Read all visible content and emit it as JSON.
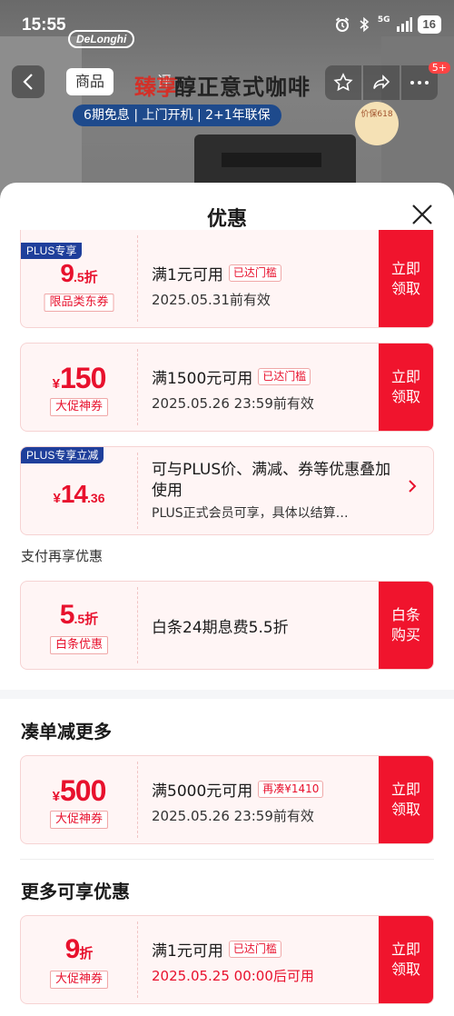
{
  "status_bar": {
    "time": "15:55",
    "network": "5G",
    "battery": "16"
  },
  "background": {
    "brand_logo": "DeLonghi",
    "tabs": [
      {
        "label": "商品"
      },
      {
        "label": "评"
      }
    ],
    "hero_title_red": "臻享",
    "hero_title": "醇正意式咖啡",
    "hero_tags": "6期免息 | 上门开机 | 2+1年联保",
    "price_guard": "价保618",
    "cart_badge": "5+"
  },
  "sheet": {
    "title": "优惠",
    "coupons_top": [
      {
        "plus_tag": "PLUS专享",
        "amount_num": "9",
        "amount_dec": ".5",
        "amount_unit": "折",
        "type": "限品类东券",
        "condition": "满1元可用",
        "status": "已达门槛",
        "validity": "2025.05.31前有效",
        "action": "立即领取"
      },
      {
        "amount_sym": "¥",
        "amount_num": "150",
        "type": "大促神券",
        "condition": "满1500元可用",
        "status": "已达门槛",
        "validity": "2025.05.26 23:59前有效",
        "action": "立即领取"
      },
      {
        "plus_tag": "PLUS专享立减",
        "amount_sym": "¥",
        "amount_num": "14",
        "amount_dec": ".36",
        "condition": "可与PLUS价、满减、券等优惠叠加使用",
        "sub": "PLUS正式会员可享，具体以结算…"
      }
    ],
    "payment_section_label": "支付再享优惠",
    "payment_coupon": {
      "amount_num": "5",
      "amount_dec": ".5",
      "amount_unit": "折",
      "type": "白条优惠",
      "condition": "白条24期息费5.5折",
      "action": "白条购买"
    },
    "bundle_section_title": "凑单减更多",
    "bundle_coupon": {
      "amount_sym": "¥",
      "amount_num": "500",
      "type": "大促神券",
      "condition": "满5000元可用",
      "status": "再凑¥1410",
      "validity": "2025.05.26 23:59前有效",
      "action": "立即领取"
    },
    "more_section_title": "更多可享优惠",
    "more_coupon": {
      "amount_num": "9",
      "amount_unit": "折",
      "type": "大促神券",
      "condition": "满1元可用",
      "status": "已达门槛",
      "validity": "2025.05.25 00:00后可用",
      "action": "立即领取"
    }
  },
  "colors": {
    "accent": "#f0142d",
    "plus_blue": "#1f3f9b",
    "coupon_bg": "#fff5f5"
  }
}
